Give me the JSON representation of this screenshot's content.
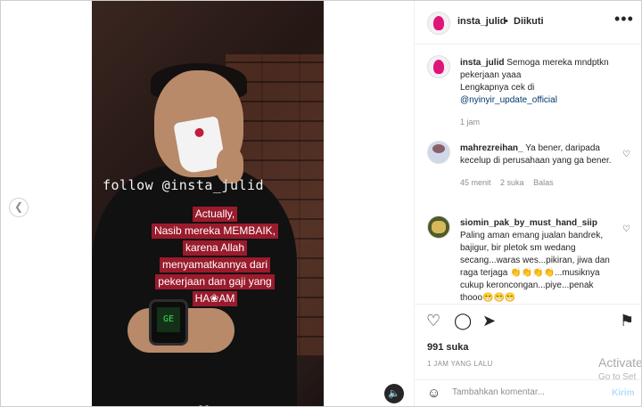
{
  "video": {
    "watermark": "follow @insta_julid",
    "caption_lines": [
      "Actually,",
      "Nasib mereka MEMBAIK,",
      "karena Allah",
      "menyamatkannya dari",
      "pekerjaan dan gaji yang",
      "HA❀AM"
    ],
    "watch_display": "GE"
  },
  "header": {
    "username": "insta_julid",
    "separator": "•",
    "follow_status": "Diikuti",
    "more_icon": "•••"
  },
  "caption_post": {
    "username": "insta_julid",
    "text": "Semoga mereka mndptkn pekerjaan yaaa",
    "text2": "Lengkapnya cek di",
    "mention": "@nyinyir_update_official",
    "time": "1 jam"
  },
  "comments": [
    {
      "username": "mahrezreihan_",
      "text": "Ya bener, daripada kecelup di perusahaan yang ga bener.",
      "time": "45 menit",
      "likes": "2 suka",
      "reply": "Balas"
    },
    {
      "username": "siomin_pak_by_must_hand_siip",
      "text": "Paling aman emang jualan bandrek, bajigur, bir pletok sm wedang secang...waras wes...pikiran, jiwa dan raga terjaga 👏👏👏👏...musiknya cukup keroncongan...piye...penak thooo😁😁😁"
    }
  ],
  "actions": {
    "like_icon": "heart-icon",
    "comment_icon": "comment-icon",
    "share_icon": "share-icon",
    "save_icon": "bookmark-icon",
    "likes_text": "991 suka",
    "time_ago": "1 JAM YANG LALU"
  },
  "comment_box": {
    "placeholder": "Tambahkan komentar...",
    "post_label": "Kirim"
  },
  "os_overlay": {
    "activate_title": "Activate",
    "activate_sub": "Go to Set"
  },
  "colors": {
    "caption_bg": "#9a1b2c",
    "link": "#00376b",
    "post_disabled": "#b2dffc"
  }
}
